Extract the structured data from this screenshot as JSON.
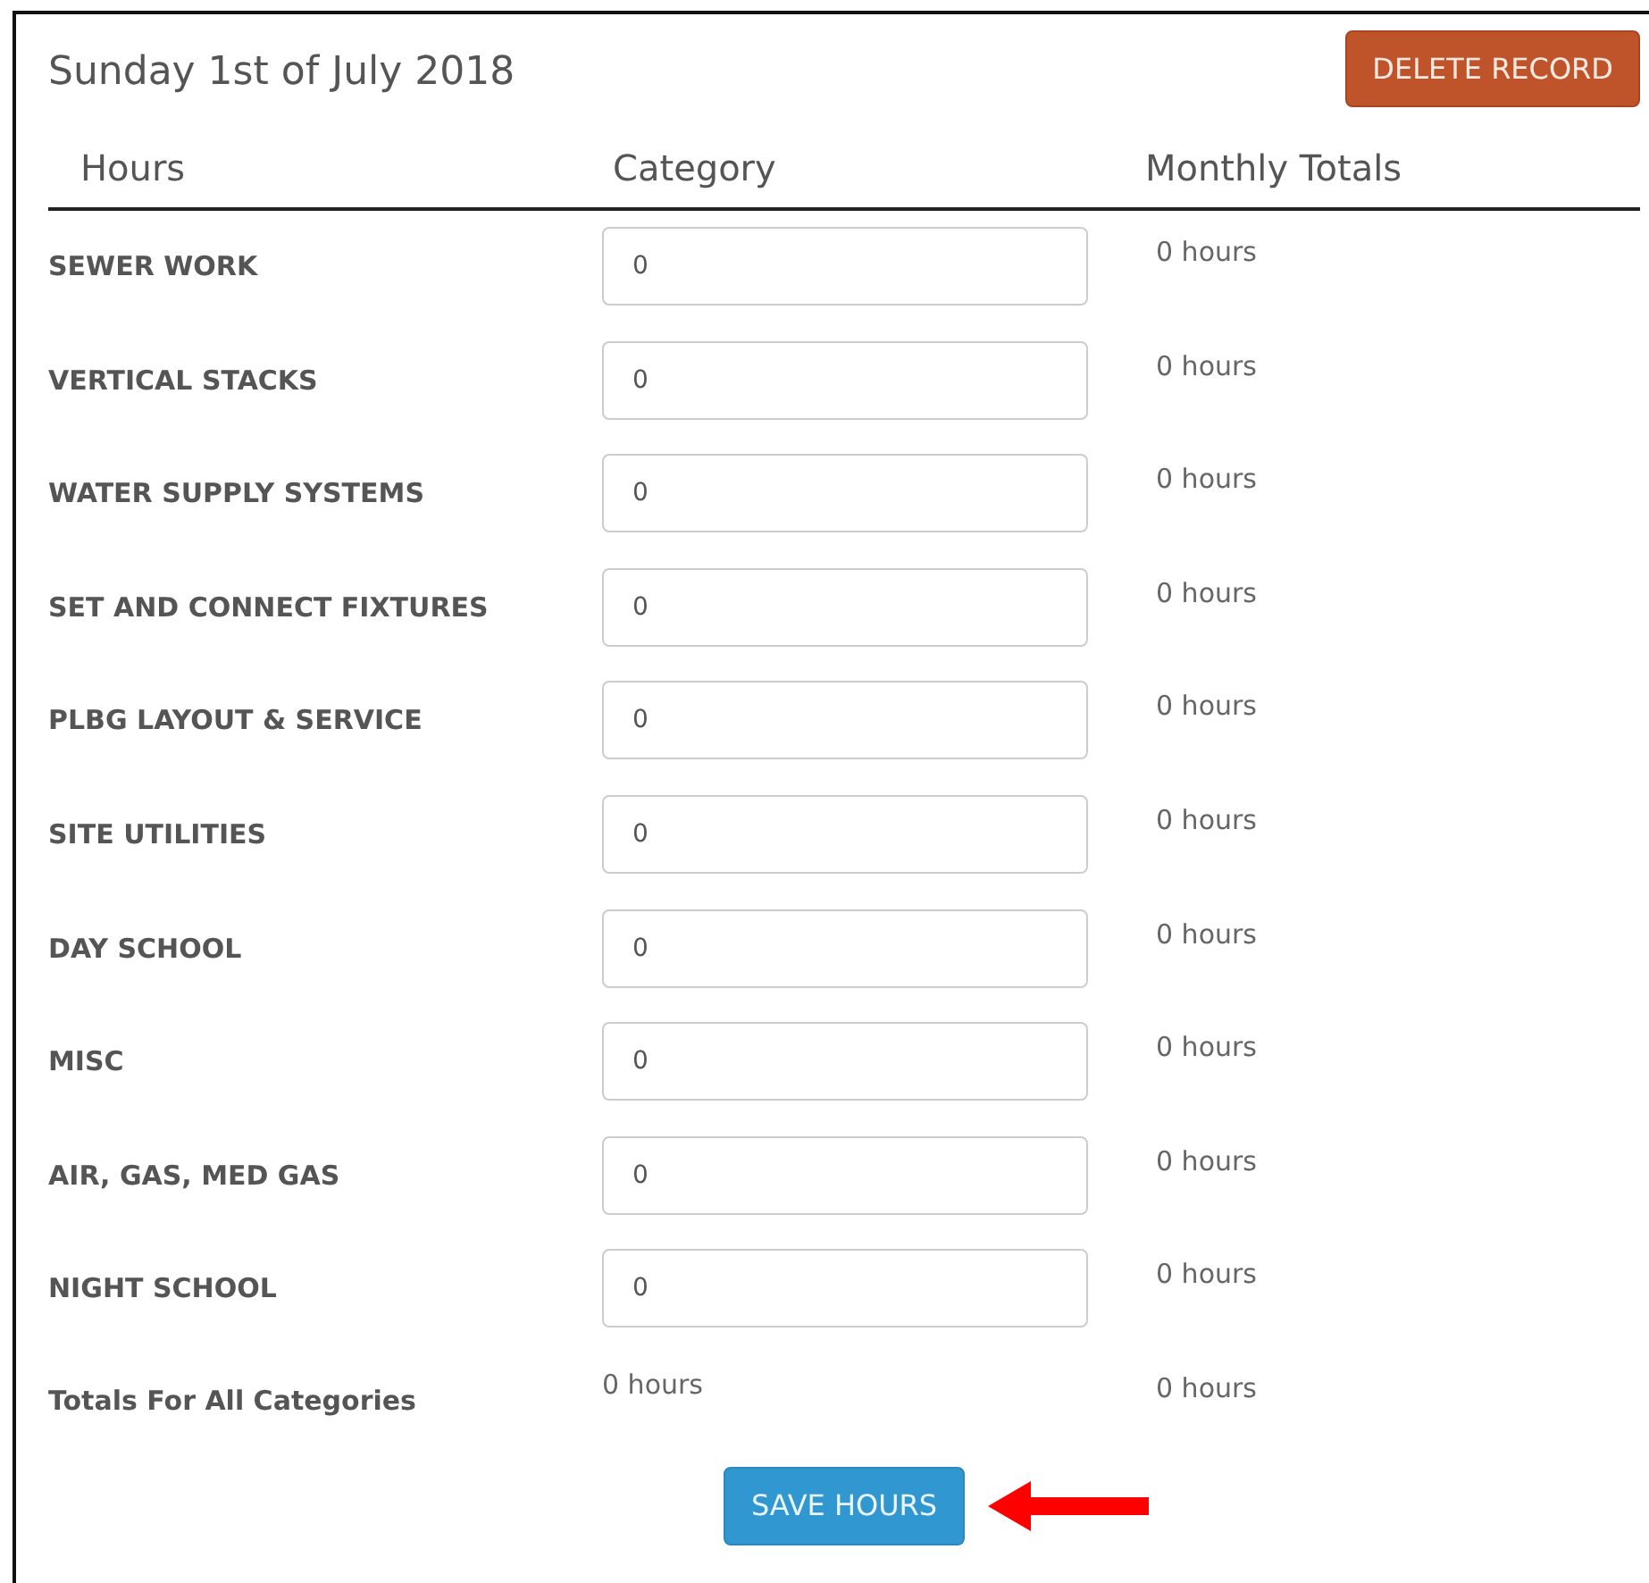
{
  "title": "Sunday 1st of July 2018",
  "delete_button": "DELETE RECORD",
  "columns": [
    "Hours",
    "Category",
    "Monthly Totals"
  ],
  "rows": [
    {
      "label": "SEWER WORK",
      "value": "0",
      "monthly": "0 hours"
    },
    {
      "label": "VERTICAL STACKS",
      "value": "0",
      "monthly": "0 hours"
    },
    {
      "label": "WATER SUPPLY SYSTEMS",
      "value": "0",
      "monthly": "0 hours"
    },
    {
      "label": "SET AND CONNECT FIXTURES",
      "value": "0",
      "monthly": "0 hours"
    },
    {
      "label": "PLBG LAYOUT & SERVICE",
      "value": "0",
      "monthly": "0 hours"
    },
    {
      "label": "SITE UTILITIES",
      "value": "0",
      "monthly": "0 hours"
    },
    {
      "label": "DAY SCHOOL",
      "value": "0",
      "monthly": "0 hours"
    },
    {
      "label": "MISC",
      "value": "0",
      "monthly": "0 hours"
    },
    {
      "label": "AIR, GAS, MED GAS",
      "value": "0",
      "monthly": "0 hours"
    },
    {
      "label": "NIGHT SCHOOL",
      "value": "0",
      "monthly": "0 hours"
    }
  ],
  "totals": {
    "label": "Totals For All Categories",
    "daily": "0 hours",
    "monthly": "0 hours"
  },
  "save_button": "SAVE HOURS"
}
